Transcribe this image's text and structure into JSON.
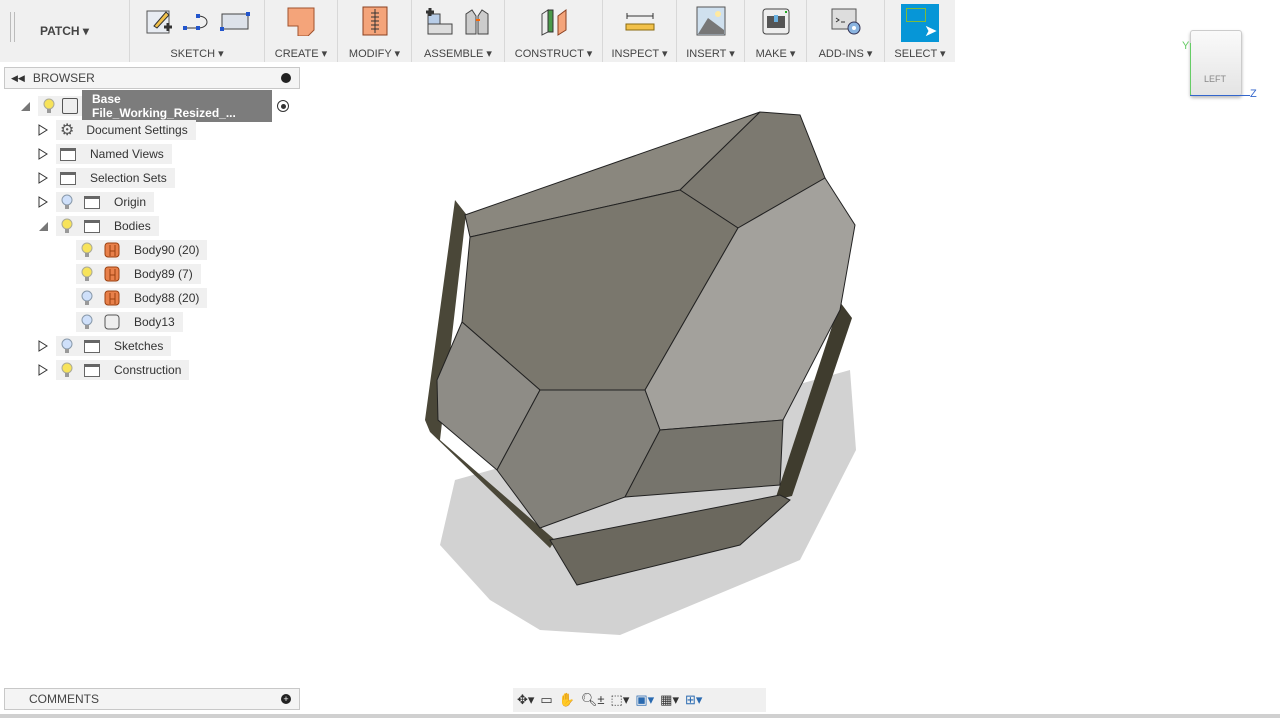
{
  "toolbar": {
    "workspace": "PATCH",
    "groups": [
      {
        "label": "SKETCH",
        "icons": [
          "create-sketch-icon",
          "spline-icon",
          "rectangle-icon"
        ]
      },
      {
        "label": "CREATE",
        "icons": [
          "create-patch-icon"
        ]
      },
      {
        "label": "MODIFY",
        "icons": [
          "modify-icon"
        ]
      },
      {
        "label": "ASSEMBLE",
        "icons": [
          "new-component-icon",
          "joint-icon"
        ]
      },
      {
        "label": "CONSTRUCT",
        "icons": [
          "construct-plane-icon"
        ]
      },
      {
        "label": "INSPECT",
        "icons": [
          "measure-icon"
        ]
      },
      {
        "label": "INSERT",
        "icons": [
          "insert-image-icon"
        ]
      },
      {
        "label": "MAKE",
        "icons": [
          "3d-print-icon"
        ]
      },
      {
        "label": "ADD-INS",
        "icons": [
          "scripts-icon"
        ]
      },
      {
        "label": "SELECT",
        "icons": [
          "select-icon"
        ]
      }
    ]
  },
  "browser": {
    "title": "BROWSER",
    "root": "Base File_Working_Resized_...",
    "items": [
      {
        "label": "Document Settings"
      },
      {
        "label": "Named Views"
      },
      {
        "label": "Selection Sets"
      },
      {
        "label": "Origin"
      },
      {
        "label": "Bodies"
      },
      {
        "label": "Body90 (20)"
      },
      {
        "label": "Body89 (7)"
      },
      {
        "label": "Body88 (20)"
      },
      {
        "label": "Body13"
      },
      {
        "label": "Sketches"
      },
      {
        "label": "Construction"
      }
    ]
  },
  "comments": {
    "title": "COMMENTS"
  },
  "viewcube": {
    "face": "LEFT",
    "axis_y": "Y",
    "axis_z": "Z"
  },
  "colors": {
    "select_active": "#0696d7",
    "body_orange": "#e8804a",
    "model_gray": "#7d7a70"
  }
}
